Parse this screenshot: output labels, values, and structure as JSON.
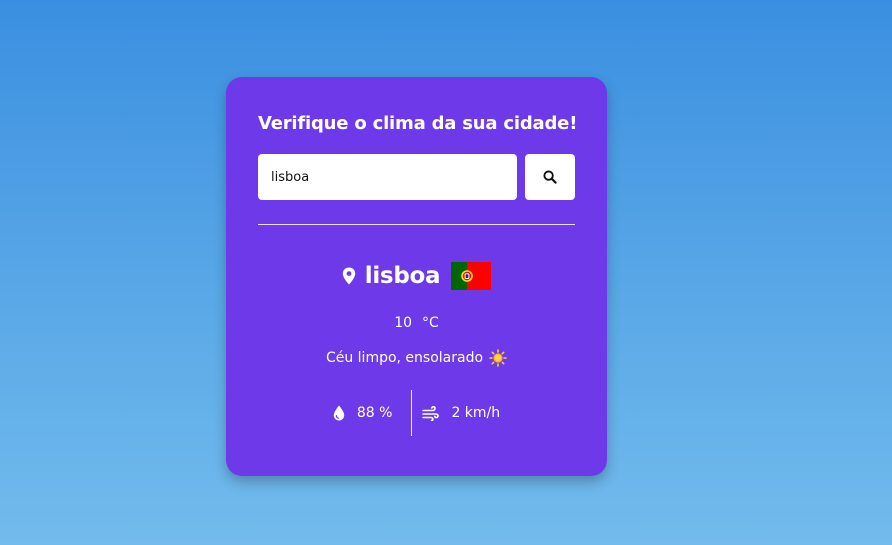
{
  "card": {
    "title": "Verifique o clima da sua cidade!",
    "search": {
      "value": "lisboa",
      "button_icon": "search-icon"
    },
    "result": {
      "city": "lisboa",
      "location_icon": "map-pin-icon",
      "flag_icon": "portugal-flag-icon",
      "temperature": "10",
      "temperature_unit": "°C",
      "description": "Céu limpo, ensolarado",
      "weather_icon": "sun-icon",
      "humidity": "88 %",
      "humidity_icon": "water-drop-icon",
      "wind": "2 km/h",
      "wind_icon": "wind-icon"
    }
  },
  "colors": {
    "background_top": "#3a8fe0",
    "background_bottom": "#72bbec",
    "card": "#6e39e8",
    "text": "#ffffff",
    "flag_green": "#006600",
    "flag_red": "#ff0000"
  }
}
